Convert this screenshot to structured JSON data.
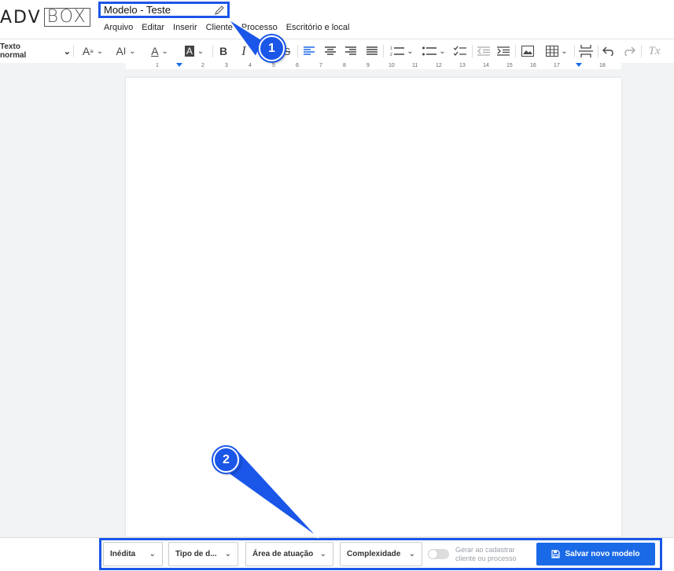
{
  "app": {
    "logo_adv": "ADV",
    "logo_box": "BOX"
  },
  "document": {
    "title": "Modelo - Teste",
    "edit_icon": "pencil-icon"
  },
  "menu": {
    "items": [
      "Arquivo",
      "Editar",
      "Inserir",
      "Cliente",
      "Processo",
      "Escritório e local"
    ]
  },
  "toolbar": {
    "style_label": "Texto normal",
    "icons": [
      "font-size-icon",
      "line-height-icon",
      "text-color-icon",
      "highlight-icon",
      "bold-icon",
      "italic-icon",
      "strikethrough-icon",
      "align-left-icon",
      "align-center-icon",
      "align-right-icon",
      "justify-icon",
      "numbered-list-icon",
      "bullet-list-icon",
      "checklist-icon",
      "outdent-icon",
      "indent-icon",
      "image-icon",
      "table-icon",
      "page-break-icon",
      "undo-icon",
      "redo-icon",
      "clear-format-icon"
    ],
    "bold": "B",
    "italic": "I",
    "clear_format": "Tx"
  },
  "ruler": {
    "ticks": [
      "1",
      "2",
      "3",
      "4",
      "5",
      "6",
      "7",
      "8",
      "9",
      "10",
      "11",
      "12",
      "13",
      "14",
      "15",
      "16",
      "17",
      "18"
    ]
  },
  "bottom": {
    "status_select": "Inédita",
    "type_select": "Tipo de d...",
    "area_select": "Área de atuação",
    "complexity_select": "Complexidade",
    "toggle_label_line1": "Gerar ao cadastrar",
    "toggle_label_line2": "cliente ou processo",
    "save_label": "Salvar novo modelo"
  },
  "callouts": [
    "1",
    "2"
  ],
  "colors": {
    "accent": "#1a56e8",
    "save_button": "#1a6ae8"
  }
}
